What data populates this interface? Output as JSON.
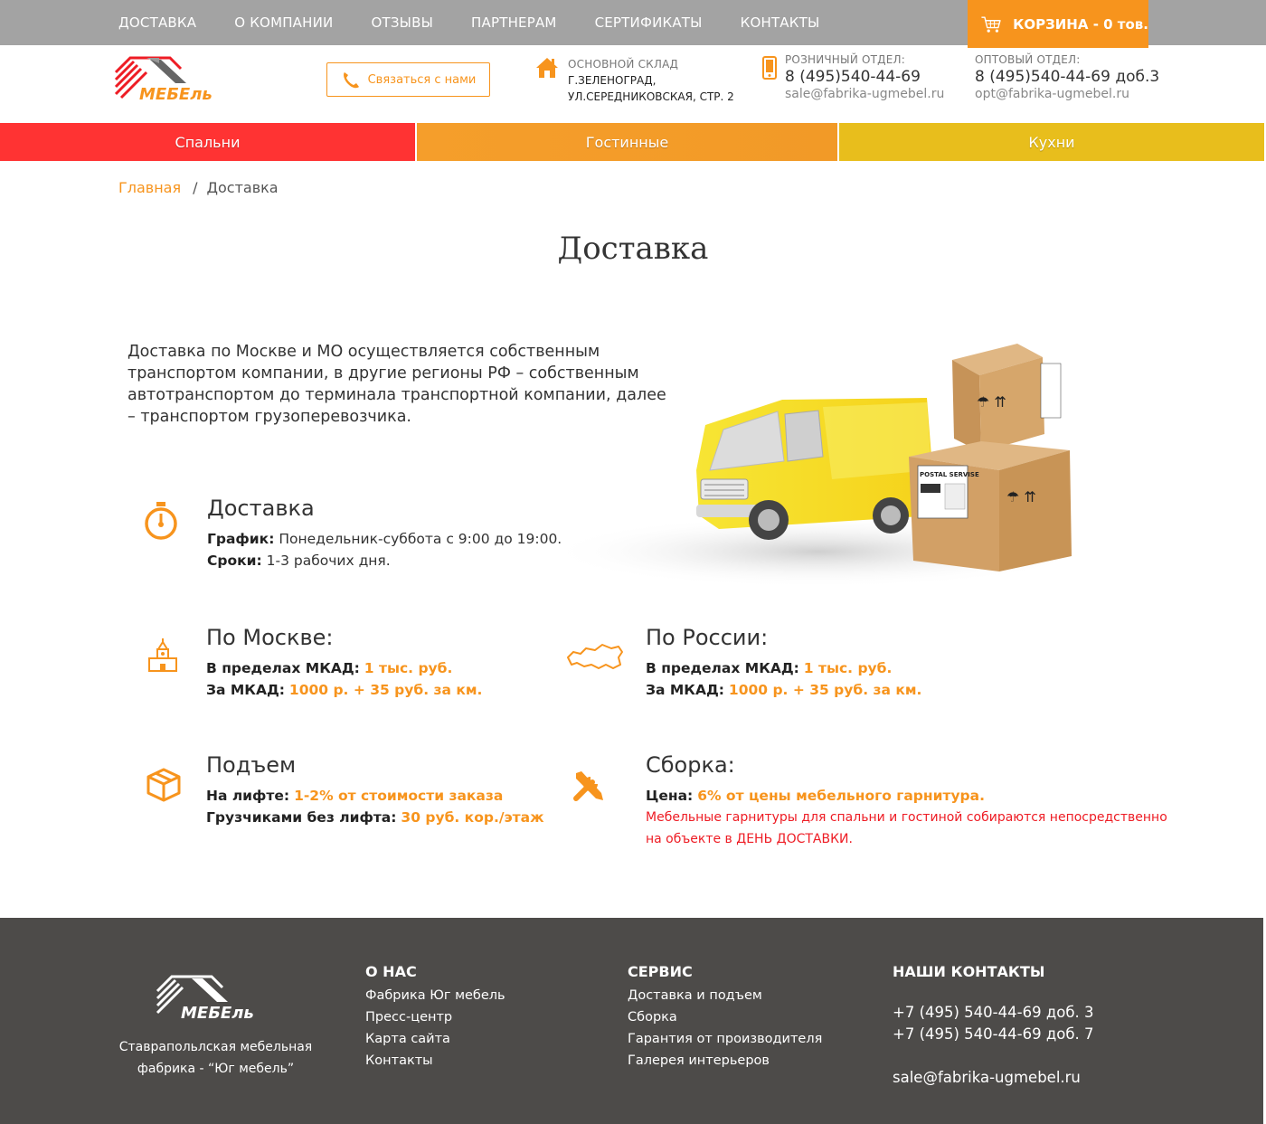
{
  "topnav": {
    "items": [
      "ДОСТАВКА",
      "О КОМПАНИИ",
      "ОТЗЫВЫ",
      "ПАРТНЕРАМ",
      "СЕРТИФИКАТЫ",
      "КОНТАКТЫ"
    ],
    "cart_label": "КОРЗИНА - 0 тов."
  },
  "header": {
    "logo_text": "МЕБЕль",
    "contact_button": "Связаться с нами",
    "warehouse": {
      "caption": "ОСНОВНОЙ СКЛАД",
      "line1": "Г.ЗЕЛЕНОГРАД,",
      "line2": "УЛ.СЕРЕДНИКОВСКАЯ, СТР. 2"
    },
    "retail": {
      "caption": "РОЗНИЧНЫЙ ОТДЕЛ:",
      "phone": "8 (495)540-44-69",
      "email": "sale@fabrika-ugmebel.ru"
    },
    "wholesale": {
      "caption": "ОПТОВЫЙ ОТДЕЛ:",
      "phone": "8 (495)540-44-69 доб.3",
      "email": "opt@fabrika-ugmebel.ru"
    }
  },
  "categories": [
    "Спальни",
    "Гостинные",
    "Кухни"
  ],
  "breadcrumb": {
    "home": "Главная",
    "sep": "/",
    "current": "Доставка"
  },
  "page_title": "Доставка",
  "intro": "Доставка по Москве и МО осуществляется собственным транспортом компании, в другие регионы РФ – собственным автотранспортом до терминала транспортной компании, далее – транспортом грузоперевозчика.",
  "hero": {
    "box_label": "POSTAL SERVISE"
  },
  "blocks": {
    "delivery": {
      "title": "Доставка",
      "l1_label": "График:",
      "l1_value": " Понедельник-суббота с 9:00 до 19:00.",
      "l2_label": "Сроки:",
      "l2_value": " 1-3 рабочих дня."
    },
    "moscow": {
      "title": "По Москве:",
      "l1_label": "В пределах МКАД:",
      "l1_value": "1 тыс. руб.",
      "l2_label": "За МКАД:",
      "l2_value": "1000 р. + 35 руб. за км."
    },
    "russia": {
      "title": "По России:",
      "l1_label": "В пределах МКАД:",
      "l1_value": "1 тыс. руб.",
      "l2_label": "За МКАД:",
      "l2_value": "1000 р. + 35 руб. за км."
    },
    "lift": {
      "title": "Подъем",
      "l1_label": "На лифте:",
      "l1_value": "1-2% от стоимости заказа",
      "l2_label": "Грузчиками без лифта:",
      "l2_value": "30 руб. кор./этаж"
    },
    "assembly": {
      "title": "Сборка:",
      "l1_label": "Цена:",
      "l1_value": "6% от цены мебельного гарнитура.",
      "note1": "Мебельные гарнитуры для спальни и гостиной собираются непосредственно",
      "note2": "на объекте в ДЕНЬ ДОСТАВКИ."
    }
  },
  "footer": {
    "tagline1": "Ставрапольлская мебельная",
    "tagline2": "фабрика - “Юг мебель”",
    "about": {
      "title": "О НАС",
      "links": [
        "Фабрика Юг мебель",
        "Пресс-центр",
        "Карта сайта",
        "Контакты"
      ]
    },
    "service": {
      "title": "СЕРВИС",
      "links": [
        "Доставка и подъем",
        "Сборка",
        "Гарантия от производителя",
        "Галерея интерьеров"
      ]
    },
    "contacts": {
      "title": "НАШИ КОНТАКТЫ",
      "phone1": "+7 (495) 540-44-69 доб. 3",
      "phone2": "+7 (495) 540-44-69 доб. 7",
      "email": "sale@fabrika-ugmebel.ru"
    }
  },
  "colors": {
    "accent": "#f7941d",
    "red": "#ff3333",
    "yellow": "#e8be1c",
    "footer": "#4d4b49",
    "topbar": "#a3a3a3"
  }
}
